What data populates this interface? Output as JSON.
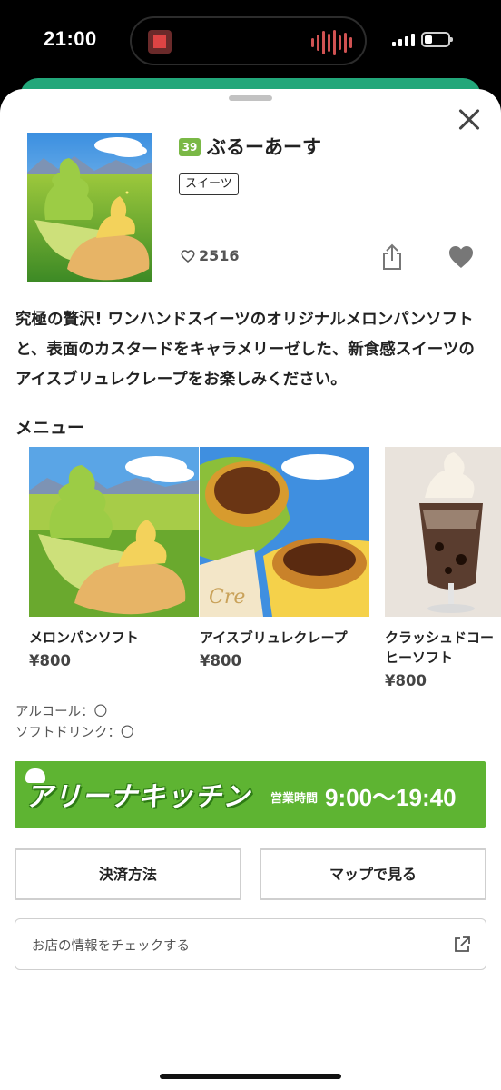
{
  "status_bar": {
    "time": "21:00"
  },
  "shop": {
    "number": "39",
    "name": "ぶるーあーす",
    "category": "スイーツ",
    "likes": "2516",
    "description": "究極の贅沢! ワンハンドスイーツのオリジナルメロンパンソフトと、表面のカスタードをキャラメリーゼした、新食感スイーツのアイスブリュレクレープをお楽しみください。"
  },
  "menu": {
    "heading": "メニュー",
    "items": [
      {
        "name": "メロンパンソフト",
        "price": "¥800"
      },
      {
        "name": "アイスブリュレクレープ",
        "price": "¥800"
      },
      {
        "name": "クラッシュドコーヒーソフト",
        "price": "¥800"
      }
    ]
  },
  "options": {
    "alcohol": "アルコール：〇",
    "soft_drink": "ソフトドリンク：〇"
  },
  "banner": {
    "logo_text": "アリーナキッチン",
    "hours_label": "営業時間",
    "hours": "9:00〜19:40"
  },
  "buttons": {
    "payment": "決済方法",
    "map": "マップで見る"
  },
  "info_link": {
    "label": "お店の情報をチェックする"
  },
  "colors": {
    "brand_green": "#5eb432",
    "badge_green": "#7ab846",
    "header_teal": "#22a77a"
  }
}
